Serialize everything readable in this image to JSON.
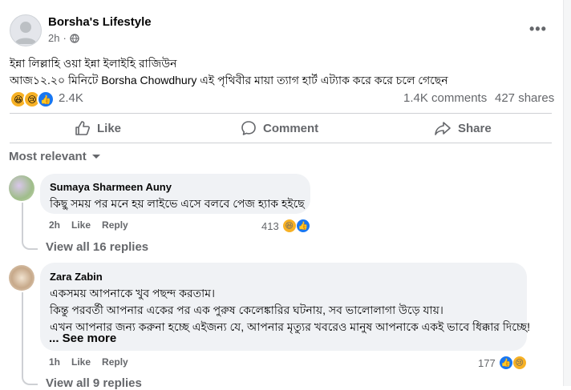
{
  "post": {
    "author": "Borsha's Lifestyle",
    "time": "2h",
    "lines": [
      "ইন্না লিল্লাহি ওয়া ইন্না ইলাইহি রাজিউন",
      "আজ১২.২০ মিনিটে Borsha Chowdhury এই পৃথিবীর মায়া ত্যাগ হার্ট এট্যাক করে  করে  চলে গেছেন"
    ],
    "reactions_count": "2.4K",
    "comments_count": "1.4K comments",
    "shares_count": "427 shares",
    "actions": {
      "like": "Like",
      "comment": "Comment",
      "share": "Share"
    },
    "reaction_icons": [
      "haha-icon",
      "sad-icon",
      "like-icon"
    ]
  },
  "sort_label": "Most relevant",
  "comments": [
    {
      "name": "Sumaya Sharmeen Auny",
      "text": [
        "কিছু সময় পর মনে হয় লাইভে এসে বলবে পেজ হ্যাক হইছে"
      ],
      "time": "2h",
      "like": "Like",
      "reply": "Reply",
      "react_count": "413",
      "view_replies": "View all 16 replies"
    },
    {
      "name": "Zara Zabin",
      "text": [
        "একসময় আপনাকে খুব পছন্দ করতাম।",
        "কিন্তু পরবর্তী আপনার একের পর এক পুরুষ কেলেঙ্কারির ঘটনায়, সব ভালোলাগা উড়ে যায়।",
        "এখন আপনার জন্য করুনা হচ্ছে এইজন্য যে, আপনার মৃত্যুর খবরেও মানুষ আপনাকে একই ভাবে ধিক্কার দিচ্ছে!"
      ],
      "see_more": "... See more",
      "time": "1h",
      "like": "Like",
      "reply": "Reply",
      "react_count": "177",
      "view_replies": "View all 9 replies"
    }
  ],
  "colors": {
    "accent": "#1877f2",
    "secondary_text": "#65676b",
    "bubble": "#f0f2f5",
    "divider": "#ced0d4"
  }
}
